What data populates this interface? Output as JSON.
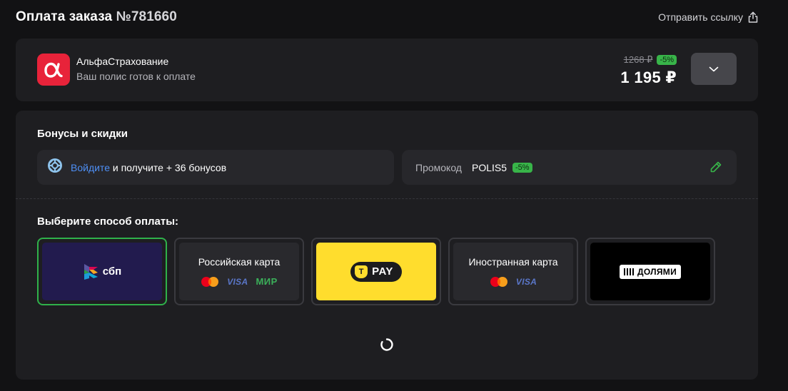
{
  "header": {
    "title_prefix": "Оплата заказа",
    "order_number": "№781660",
    "share_label": "Отправить ссылку"
  },
  "order": {
    "company_name": "АльфаСтрахование",
    "status": "Ваш полис готов к оплате",
    "old_price": "1268 ₽",
    "discount_badge": "-5%",
    "price": "1 195 ₽",
    "logo_glyph": "α",
    "brand_color": "#e8233a"
  },
  "bonuses": {
    "title": "Бонусы и скидки",
    "login_link": "Войдите",
    "login_text": " и получите + 36 бонусов",
    "promo_label": "Промокод",
    "promo_code": "POLIS5",
    "promo_badge": "-5%"
  },
  "payment": {
    "title": "Выберите способ оплаты:",
    "selected": "sbp",
    "methods": [
      {
        "id": "sbp",
        "logo_text": "сбп"
      },
      {
        "id": "russian-card",
        "label": "Российская карта",
        "logos": [
          "mastercard",
          "VISA",
          "МИР"
        ]
      },
      {
        "id": "tpay",
        "logo_text": "PAY",
        "shield_letter": "T"
      },
      {
        "id": "foreign-card",
        "label": "Иностранная карта",
        "logos": [
          "mastercard",
          "VISA"
        ]
      },
      {
        "id": "dolyami",
        "logo_text": "ДОЛЯМИ"
      }
    ]
  },
  "colors": {
    "accent_green": "#2fb14a",
    "link_blue": "#4e8ff5",
    "tpay_yellow": "#ffdd2d",
    "sbp_bg": "#221b4e"
  },
  "icons": {
    "share": "share-icon",
    "expand": "chevron-down-icon",
    "bonus": "bonus-icon",
    "edit": "pencil-icon",
    "loading": "spinner-icon"
  }
}
